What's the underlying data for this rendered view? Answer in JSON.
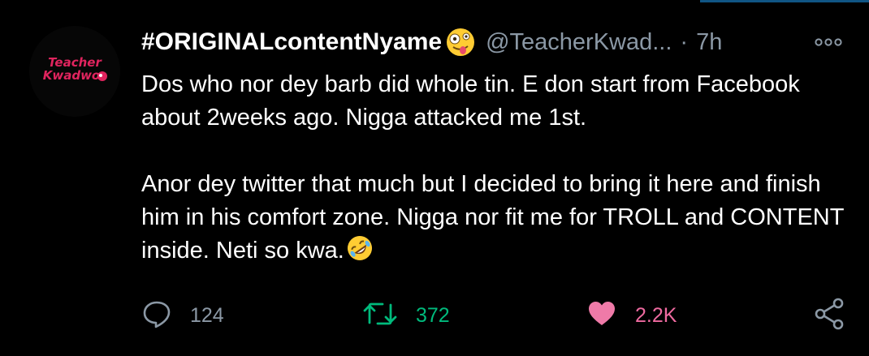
{
  "tweet": {
    "display_name": "#ORIGINALcontentNyame",
    "name_emoji": "zany-face-emoji",
    "handle": "@TeacherKwad...",
    "separator": "·",
    "time": "7h",
    "avatar_text_line1": "Teacher",
    "avatar_text_line2": "Kwadwo",
    "paragraph1": "Dos who nor dey barb did whole tin. E don start from Facebook about 2weeks ago. Nigga attacked me 1st.",
    "paragraph2": "Anor dey twitter that much but I decided to bring it here and finish him in his comfort zone. Nigga nor fit me for TROLL and CONTENT inside. Neti so kwa.",
    "paragraph2_emoji": "rolling-on-floor-laughing-emoji"
  },
  "actions": {
    "reply_count": "124",
    "retweet_count": "372",
    "like_count": "2.2K",
    "reply_icon": "reply-icon",
    "retweet_icon": "retweet-icon",
    "like_icon": "heart-icon",
    "share_icon": "share-icon"
  },
  "colors": {
    "background": "#000000",
    "text": "#ffffff",
    "muted": "#8b98a5",
    "retweet_green": "#00ba7c",
    "like_pink": "#ef6aa0",
    "avatar_text": "#e0245e"
  }
}
